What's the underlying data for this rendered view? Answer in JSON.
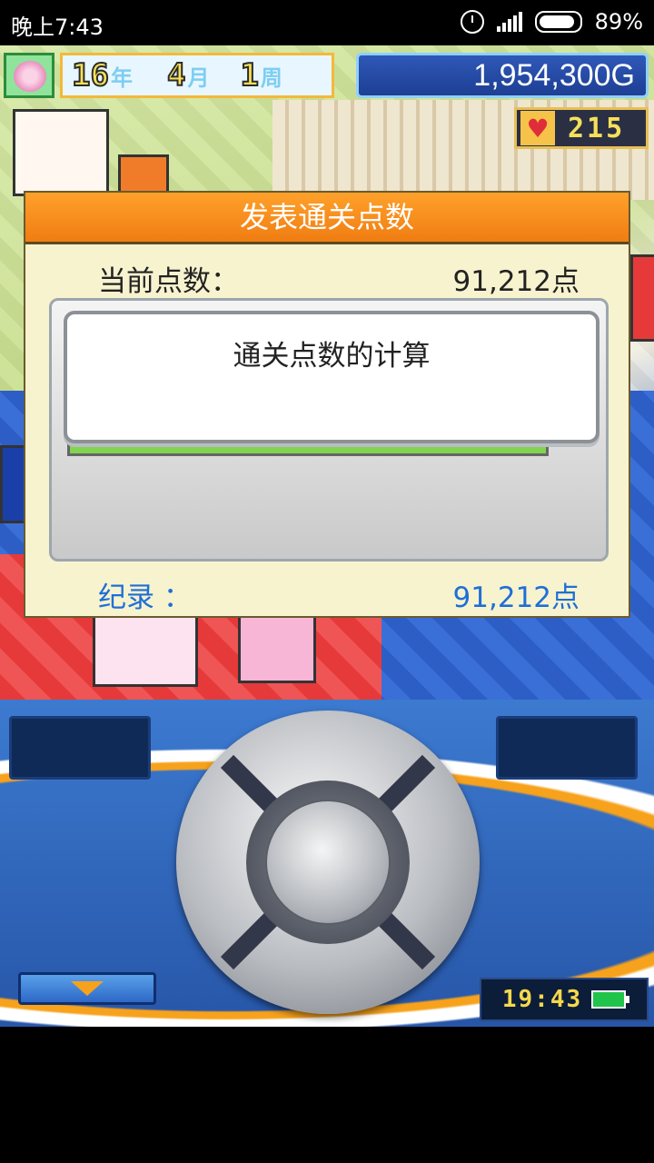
{
  "status_bar": {
    "time": "晚上7:43",
    "battery_percent": "89%"
  },
  "hud": {
    "year_num": "16",
    "year_unit": "年",
    "month_num": "4",
    "month_unit": "月",
    "week_num": "1",
    "week_unit": "周",
    "money": "1,954,300G",
    "hearts": "215"
  },
  "dialog": {
    "title": "发表通关点数",
    "current_label": "当前点数：",
    "current_value": "91,212点",
    "message": "通关点数的计算",
    "record_label": "纪录 ：",
    "record_value": "91,212点"
  },
  "controller": {
    "clock": "19:43",
    "battery_icon": "battery-full-icon"
  },
  "colors": {
    "dialog_title_bg": "#f07d12",
    "record_text": "#1f6fd6",
    "controller_bg": "#2f68c0"
  }
}
